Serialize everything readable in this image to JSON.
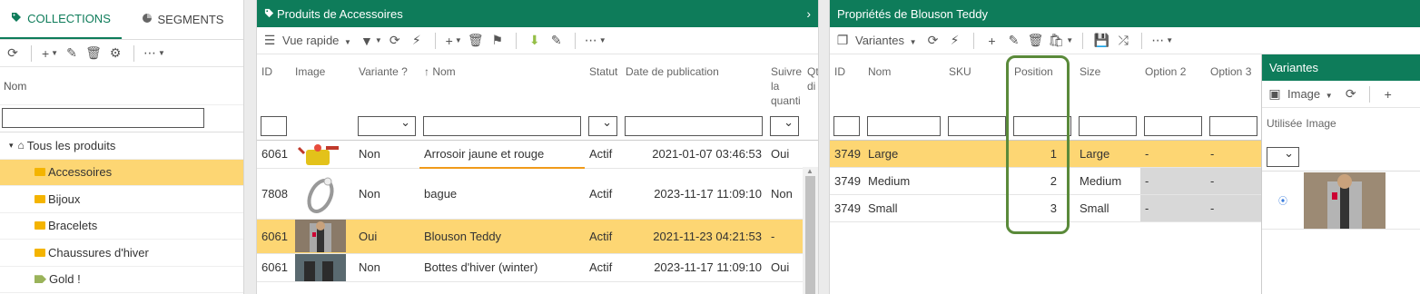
{
  "left": {
    "tabs": {
      "collections": "COLLECTIONS",
      "segments": "SEGMENTS"
    },
    "column_header": "Nom",
    "tree": {
      "root": "Tous les produits",
      "items": [
        "Accessoires",
        "Bijoux",
        "Bracelets",
        "Chaussures d'hiver",
        "Gold !"
      ]
    }
  },
  "middle": {
    "title": "Produits de Accessoires",
    "toolbar": {
      "view": "Vue rapide"
    },
    "columns": {
      "id": "ID",
      "image": "Image",
      "variant": "Variante ?",
      "name": "Nom",
      "status": "Statut",
      "date": "Date de publication",
      "track": "Suivre la quanti",
      "qty": "Qt di"
    },
    "rows": [
      {
        "id": "6061",
        "variant": "Non",
        "name": "Arrosoir jaune et rouge",
        "status": "Actif",
        "date": "2021-01-07 03:46:53",
        "track": "Oui"
      },
      {
        "id": "7808",
        "variant": "Non",
        "name": "bague",
        "status": "Actif",
        "date": "2023-11-17 11:09:10",
        "track": "Non"
      },
      {
        "id": "6061",
        "variant": "Oui",
        "name": "Blouson Teddy",
        "status": "Actif",
        "date": "2021-11-23 04:21:53",
        "track": "-"
      },
      {
        "id": "6061",
        "variant": "Non",
        "name": "Bottes d'hiver (winter)",
        "status": "Actif",
        "date": "2023-11-17 11:09:10",
        "track": "Oui"
      }
    ]
  },
  "right": {
    "title": "Propriétés de Blouson Teddy",
    "toolbar": {
      "view": "Variantes"
    },
    "columns": {
      "id": "ID",
      "name": "Nom",
      "sku": "SKU",
      "position": "Position",
      "size": "Size",
      "option2": "Option 2",
      "option3": "Option 3"
    },
    "rows": [
      {
        "id": "3749",
        "name": "Large",
        "sku": "",
        "position": "1",
        "size": "Large",
        "option2": "-",
        "option3": "-"
      },
      {
        "id": "3749",
        "name": "Medium",
        "sku": "",
        "position": "2",
        "size": "Medium",
        "option2": "-",
        "option3": "-"
      },
      {
        "id": "3749",
        "name": "Small",
        "sku": "",
        "position": "3",
        "size": "Small",
        "option2": "-",
        "option3": "-"
      }
    ]
  },
  "variants_panel": {
    "title": "Variantes",
    "toolbar": {
      "view": "Image"
    },
    "columns": {
      "used": "Utilisée",
      "image": "Image"
    }
  },
  "colors": {
    "brand_green": "#0e7c5a",
    "selection_yellow": "#fdd673",
    "highlight_green": "#5a8a3a"
  }
}
